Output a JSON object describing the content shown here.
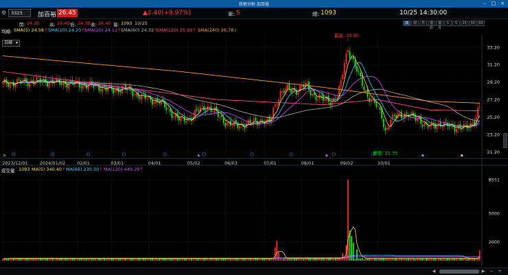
{
  "window": {
    "title": "技術分析-加百裕"
  },
  "quote": {
    "code": "3323",
    "name": "加百裕",
    "price": "26.45",
    "change": "▲2.40(+9.97%)",
    "unit_label": "單:",
    "unit_value": "S",
    "volume_label": "總:",
    "volume_value": "1093",
    "datetime": "10/25 14:30:00"
  },
  "ohlc": {
    "open_label": "開:",
    "open": "24.35",
    "high_label": "高:",
    "high": "26.45",
    "low_label": "低:",
    "low": "24.35",
    "close_label": "收:",
    "close": "26.45",
    "vol_label": "量:",
    "vol": "1093",
    "date": "10/25"
  },
  "periods": [
    {
      "label": "日",
      "active": true
    },
    {
      "label": "週"
    },
    {
      "label": "月"
    },
    {
      "label": "還原"
    },
    {
      "label": "還月"
    },
    {
      "label": "1"
    },
    {
      "label": "5"
    },
    {
      "label": "15"
    },
    {
      "label": "30"
    },
    {
      "label": "60"
    }
  ],
  "range_select": "日線",
  "sma_legend": {
    "prefix": "均線:",
    "items": [
      {
        "text": "SMA(5) 24.58",
        "arrow": "↑",
        "color": "#ffe14d"
      },
      {
        "text": "SMA(10) 24.20",
        "arrow": "↑",
        "color": "#34d3ff"
      },
      {
        "text": "SMA(20) 24.11",
        "arrow": "↑",
        "color": "#d056ff"
      },
      {
        "text": "SMA(60) 24.32",
        "arrow": "↑",
        "color": "#b8b8b8"
      },
      {
        "text": "SMA(120) 25.90",
        "arrow": "↑",
        "color": "#ff4b8b"
      },
      {
        "text": "SMA(240) 26.78",
        "arrow": "↓",
        "color": "#ff9a3a"
      }
    ]
  },
  "colors": {
    "up": "#ff2a2a",
    "down": "#19e619",
    "grid": "#1e2a36",
    "accent": "#0b5a9e"
  },
  "annotations": {
    "high_label": "最高: 33.90",
    "low_label": "最低: 21.35"
  },
  "volume_legend": {
    "title": "成交量",
    "value": "1093",
    "items": [
      {
        "text": "MA(5) 340.40",
        "arrow": "↑",
        "color": "#ffe14d"
      },
      {
        "text": "MA(66) 230.30",
        "arrow": "↑",
        "color": "#34d3ff"
      },
      {
        "text": "MA(120) 449.29",
        "arrow": "↑",
        "color": "#d056ff"
      }
    ]
  },
  "chart_data": {
    "type": "candlestick",
    "price_axis": {
      "ticks": [
        21.2,
        23.2,
        25.2,
        27.2,
        29.2,
        31.2,
        33.2
      ],
      "range": [
        20.6,
        34.6
      ]
    },
    "volume_axis": {
      "ticks": [
        2000,
        5000,
        8551
      ],
      "range": [
        0,
        9000
      ]
    },
    "x_ticks": [
      "2023/12/01",
      "2024/01/02",
      "02/01",
      "03/01",
      "04/01",
      "05/02",
      "06/03",
      "07/01",
      "08/01",
      "09/02",
      "10/01"
    ],
    "anchors": [
      [
        0,
        29.0
      ],
      [
        10,
        29.2
      ],
      [
        20,
        29.3
      ],
      [
        30,
        29.2
      ],
      [
        40,
        29.0
      ],
      [
        50,
        28.8
      ],
      [
        58,
        28.5
      ],
      [
        62,
        28.2
      ],
      [
        68,
        28.6
      ],
      [
        75,
        27.8
      ],
      [
        82,
        27.2
      ],
      [
        88,
        27.0
      ],
      [
        95,
        25.6
      ],
      [
        100,
        24.8
      ],
      [
        105,
        25.0
      ],
      [
        110,
        26.0
      ],
      [
        115,
        26.4
      ],
      [
        120,
        25.6
      ],
      [
        125,
        24.6
      ],
      [
        130,
        24.2
      ],
      [
        138,
        24.4
      ],
      [
        145,
        24.8
      ],
      [
        150,
        24.6
      ],
      [
        152,
        26.0
      ],
      [
        156,
        28.0
      ],
      [
        160,
        28.4
      ],
      [
        165,
        28.2
      ],
      [
        170,
        28.9
      ],
      [
        175,
        27.6
      ],
      [
        180,
        27.2
      ],
      [
        185,
        27.0
      ],
      [
        188,
        27.6
      ],
      [
        190,
        29.0
      ],
      [
        192,
        31.5
      ],
      [
        194,
        33.0
      ],
      [
        196,
        32.0
      ],
      [
        200,
        30.0
      ],
      [
        205,
        27.6
      ],
      [
        210,
        26.5
      ],
      [
        213,
        25.4
      ],
      [
        215,
        23.5
      ],
      [
        218,
        24.8
      ],
      [
        222,
        25.5
      ],
      [
        228,
        25.4
      ],
      [
        234,
        25.0
      ],
      [
        238,
        24.0
      ],
      [
        244,
        24.4
      ],
      [
        250,
        24.2
      ],
      [
        256,
        24.0
      ],
      [
        261,
        24.0
      ],
      [
        265,
        24.8
      ],
      [
        268,
        26.45
      ]
    ],
    "sma240": [
      [
        0,
        32.2
      ],
      [
        100,
        30.4
      ],
      [
        180,
        28.6
      ],
      [
        240,
        27.0
      ],
      [
        268,
        26.78
      ]
    ],
    "sma120": [
      [
        0,
        30.4
      ],
      [
        60,
        28.8
      ],
      [
        120,
        27.2
      ],
      [
        180,
        26.6
      ],
      [
        210,
        27.2
      ],
      [
        240,
        26.0
      ],
      [
        268,
        25.9
      ]
    ],
    "volume_spikes": [
      [
        153,
        1400
      ],
      [
        154,
        2100
      ],
      [
        155,
        900
      ],
      [
        191,
        800
      ],
      [
        193,
        1600
      ],
      [
        194,
        8551
      ],
      [
        195,
        3200
      ],
      [
        196,
        2600
      ],
      [
        197,
        1900
      ],
      [
        199,
        1200
      ],
      [
        268,
        1093
      ]
    ],
    "volume_base": 260
  }
}
